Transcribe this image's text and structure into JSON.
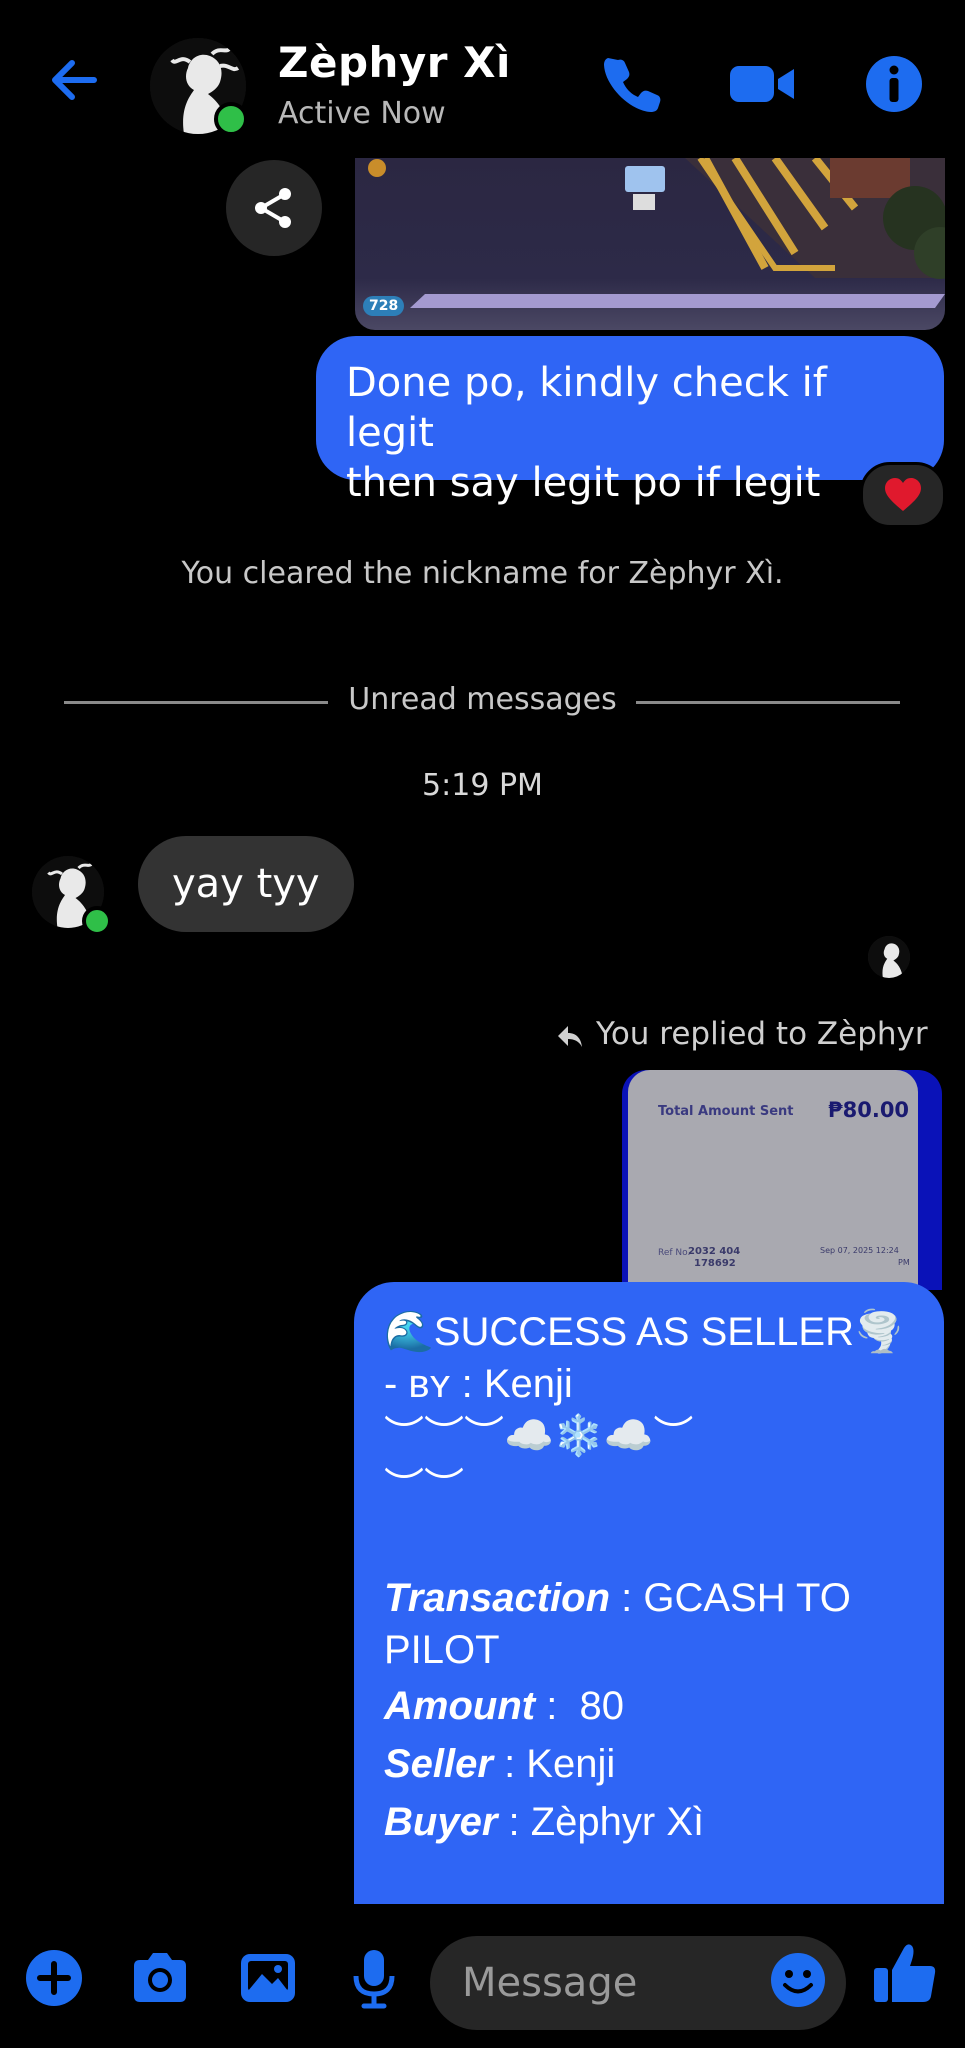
{
  "header": {
    "name": "Zèphyr Xì",
    "status": "Active Now",
    "icons": [
      "back-arrow-icon",
      "phone-icon",
      "video-camera-icon",
      "info-icon"
    ]
  },
  "thread": {
    "shared_image_gem_count": "728",
    "outgoing_message_1": {
      "lines": [
        "Done po, kindly check if legit",
        "then say legit po if legit"
      ],
      "reaction": "❤️"
    },
    "system_notice": "You cleared the nickname for Zèphyr Xì.",
    "unread_divider": "Unread messages",
    "timestamp": "5:19 PM",
    "incoming_message": "yay tyy",
    "reply_context": "You replied to Zèphyr",
    "receipt": {
      "total_label": "Total Amount Sent",
      "total_value": "₱80.00",
      "ref_label": "Ref No.",
      "ref_value_1": "2032 404",
      "ref_value_2": "178692",
      "date_1": "Sep 07, 2025 12:24",
      "date_2": "PM"
    },
    "outgoing_message_2": {
      "title": "🌊SUCCESS AS SELLER🌪️",
      "by_prefix": "- ʙʏ : ",
      "by_name": "Kenji",
      "deco_1": "︶︶︶☁️❄️☁️︶",
      "deco_2": "︶︶",
      "transaction_label": "Transaction",
      "transaction_value": " : GCASH TO PILOT",
      "amount_label": "Amount",
      "amount_value": " :  80",
      "seller_label": "Seller",
      "seller_value": " : Kenji",
      "buyer_label": "Buyer",
      "buyer_value": " : Zèphyr Xì"
    }
  },
  "composer": {
    "placeholder": "Message",
    "icons": [
      "plus-icon",
      "camera-icon",
      "gallery-icon",
      "microphone-icon",
      "emoji-icon",
      "thumbs-up-icon"
    ]
  },
  "colors": {
    "accent": "#2f65f5",
    "icon_blue": "#1d6cf0",
    "online": "#2fbf48",
    "incoming_bubble": "#333333"
  }
}
